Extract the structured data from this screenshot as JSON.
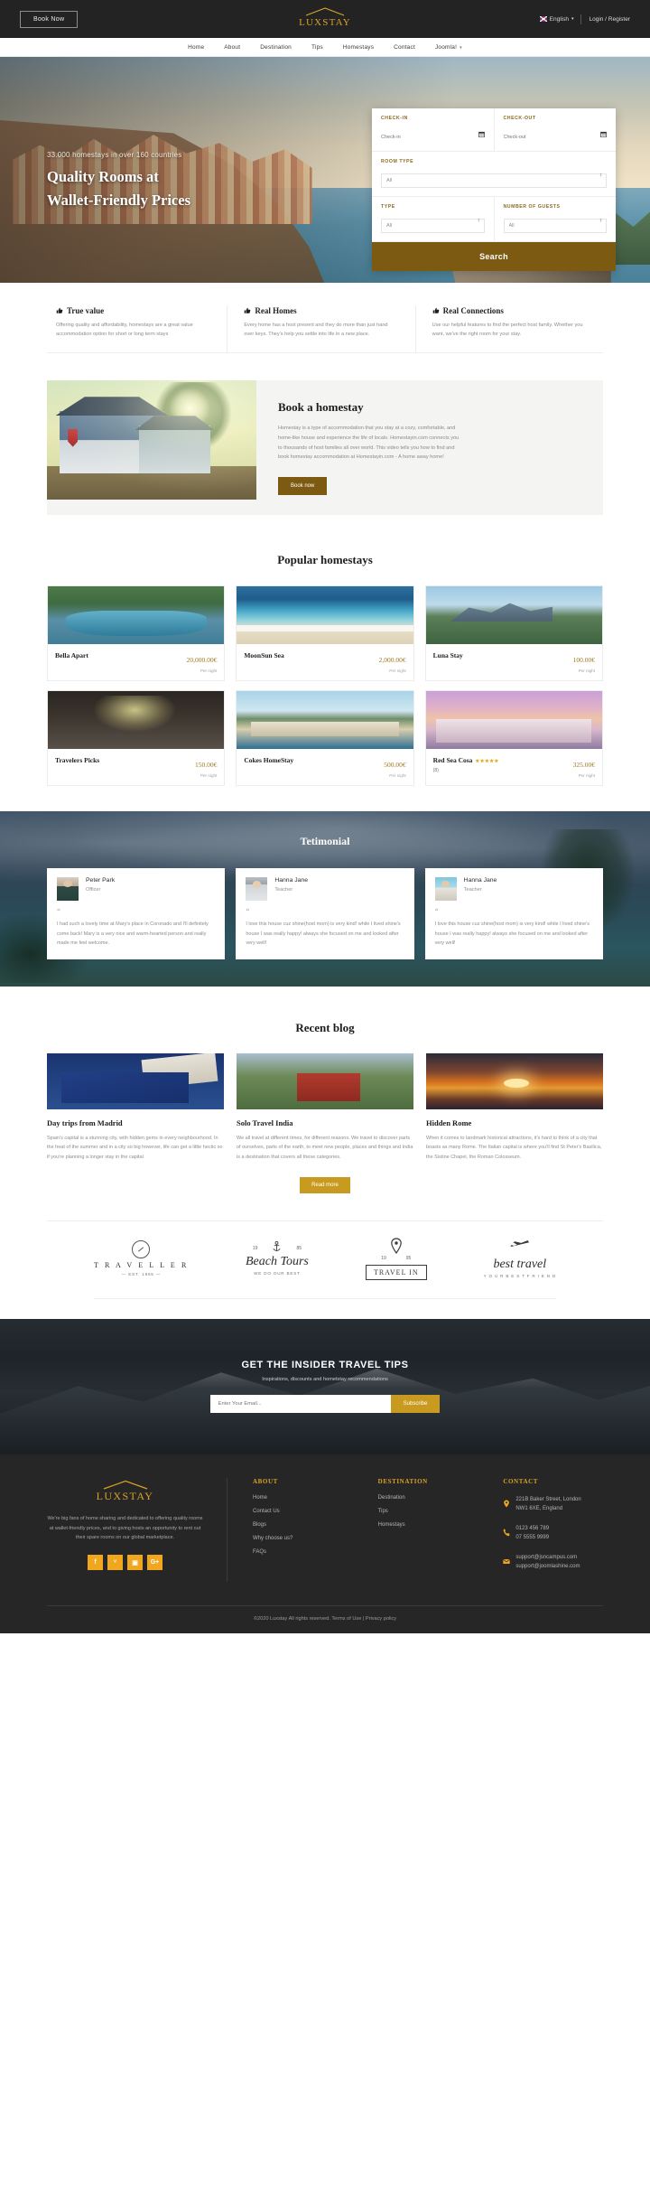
{
  "topbar": {
    "book_now": "Book Now",
    "brand": "LUXSTAY",
    "language": "English",
    "account": "Login / Register"
  },
  "nav": {
    "items": [
      {
        "label": "Home",
        "caret": false
      },
      {
        "label": "About",
        "caret": false
      },
      {
        "label": "Destination",
        "caret": false
      },
      {
        "label": "Tips",
        "caret": false
      },
      {
        "label": "Homestays",
        "caret": false
      },
      {
        "label": "Contact",
        "caret": false
      },
      {
        "label": "Joomla!",
        "caret": true
      }
    ]
  },
  "hero": {
    "subtitle": "33.000 homestays in over 160 countries",
    "title_line1": "Quality Rooms at",
    "title_line2": "Wallet-Friendly Prices"
  },
  "search": {
    "checkin_label": "CHECK-IN",
    "checkin_placeholder": "Check-in",
    "checkout_label": "CHECK-OUT",
    "checkout_placeholder": "Check-out",
    "roomtype_label": "ROOM TYPE",
    "roomtype_value": "All",
    "type_label": "TYPE",
    "type_value": "All",
    "guests_label": "NUMBER OF GUESTS",
    "guests_value": "All",
    "button": "Search",
    "accent": "#7d5a12"
  },
  "features": [
    {
      "title": "True value",
      "text": "Offering quality and affordability, homestays are a great value accommodation option for short or long term stays"
    },
    {
      "title": "Real Homes",
      "text": "Every home has a host present and they do more than just hand over keys. They's help you settle into life in a new place."
    },
    {
      "title": "Real Connections",
      "text": "Use our helpful features to find the perfect host family. Whether you want, we've the right room for your stay."
    }
  ],
  "bookstay": {
    "title": "Book a homestay",
    "text": "Homestay is a type of accommodation that you stay at a cozy, comfortable, and home-like house and experience the life of locals. Homestayin.com connects you to thousands of host families all over world. This video tells you how to find and book homestay accommodation at Homestayin.com - A home away home!",
    "button": "Book now"
  },
  "popular": {
    "title": "Popular homestays",
    "unit": "Per night",
    "cards": [
      {
        "name": "Bella Apart",
        "price": "20,000.00€",
        "scene": "sc-a",
        "stars": "",
        "count": ""
      },
      {
        "name": "MoonSun Sea",
        "price": "2,000.00€",
        "scene": "sc-b",
        "stars": "",
        "count": ""
      },
      {
        "name": "Luna Stay",
        "price": "100.00€",
        "scene": "sc-c",
        "stars": "",
        "count": ""
      },
      {
        "name": "Travelers Picks",
        "price": "150.00€",
        "scene": "sc-d",
        "stars": "",
        "count": ""
      },
      {
        "name": "Cokes HomeStay",
        "price": "500.00€",
        "scene": "sc-e",
        "stars": "",
        "count": ""
      },
      {
        "name": "Red Sea Cosa",
        "price": "325.00€",
        "scene": "sc-f",
        "stars": "★★★★★",
        "count": "(8)"
      }
    ]
  },
  "testimonial": {
    "title": "Tetimonial",
    "items": [
      {
        "name": "Peter Park",
        "role": "Officer",
        "quote": "“",
        "text": "I had such a lovely time at Mary's place in Coronado and I'll definitely come back! Mary is a very nice and warm-hearted person and really made me feel welcome."
      },
      {
        "name": "Hanna Jane",
        "role": "Teacher",
        "quote": "“",
        "text": "I love this house cuz shine(host mom) is very kind! while I lived shine's house I was really happy! always she focused on me and looked after very well!"
      },
      {
        "name": "Hanna Jane",
        "role": "Teacher",
        "quote": "“",
        "text": "I love this house cuz shine(host mom) is very kind! while I lived shine's house I was really happy! always she focused on me and looked after very well!"
      }
    ]
  },
  "blog": {
    "title": "Recent blog",
    "read_more": "Read more",
    "posts": [
      {
        "title": "Day trips from Madrid",
        "text": "Spain's capital is a stunning city, with hidden gems in every neighbourhood. In the heat of the summer and in a city so big however, life can get a little hectic so if you're planning a longer stay in the capital"
      },
      {
        "title": "Solo Travel India",
        "text": "We all travel at different times, for different reasons. We travel to discover parts of ourselves, parts of the earth, to meet new people, places and things and India is a destination that covers all these categories."
      },
      {
        "title": "Hidden Rome",
        "text": "When it comes to landmark historical attractions, it's hard to think of a city that boasts as many Rome. The Italian capital is where you'll find St Peter's Basilica, the Sistine Chapel, the Roman Colosseum."
      }
    ]
  },
  "partners": [
    {
      "kind": "circle",
      "top": "T R A V E L L E R",
      "sub": "— EST. 1965 —"
    },
    {
      "kind": "script",
      "year_left": "19",
      "year_right": "85",
      "main": "Beach Tours",
      "sub": "WE DO OUR BEST"
    },
    {
      "kind": "pin",
      "year_left": "19",
      "year_right": "95",
      "main": "TRAVEL IN"
    },
    {
      "kind": "plane",
      "main": "best travel",
      "sub": "Y O U R  B E S T  F R I E N D"
    }
  ],
  "newsletter": {
    "title": "GET THE INSIDER TRAVEL TIPS",
    "subtitle": "Inspirations, discounts and hometstay recommendations",
    "placeholder": "Enter Your Email...",
    "button": "Subscribe",
    "accent": "#c89b20"
  },
  "footer": {
    "brand": "LUXSTAY",
    "about": "We're big fans of home sharing and dedicated to offering quality rooms at wallet-friendly prices, and to giving hosts an opportunity to rent out their spare rooms on our global marketplace.",
    "social": [
      {
        "name": "facebook",
        "glyph": "f"
      },
      {
        "name": "twitter",
        "glyph": "ᵛ"
      },
      {
        "name": "instagram",
        "glyph": "▣"
      },
      {
        "name": "google-plus",
        "glyph": "G+"
      }
    ],
    "columns": [
      {
        "heading": "ABOUT",
        "links": [
          "Home",
          "Contact Us",
          "Blogs",
          "Why choose us?",
          "FAQs"
        ]
      },
      {
        "heading": "DESTINATION",
        "links": [
          "Destination",
          "Tips",
          "Homestays"
        ]
      }
    ],
    "contact_heading": "CONTACT",
    "contact": [
      {
        "icon": "location-pin-icon",
        "line1": "221B Baker Street, London",
        "line2": "NW1 6XE, England"
      },
      {
        "icon": "phone-icon",
        "line1": "0123 456 789",
        "line2": "07 5555 9999"
      },
      {
        "icon": "mail-icon",
        "line1": "support@jsncampus.com",
        "line2": "support@joomlashine.com"
      }
    ],
    "copyright": "©2020 Luxstay All rights reserved. Terms of Use | Privacy policy"
  }
}
